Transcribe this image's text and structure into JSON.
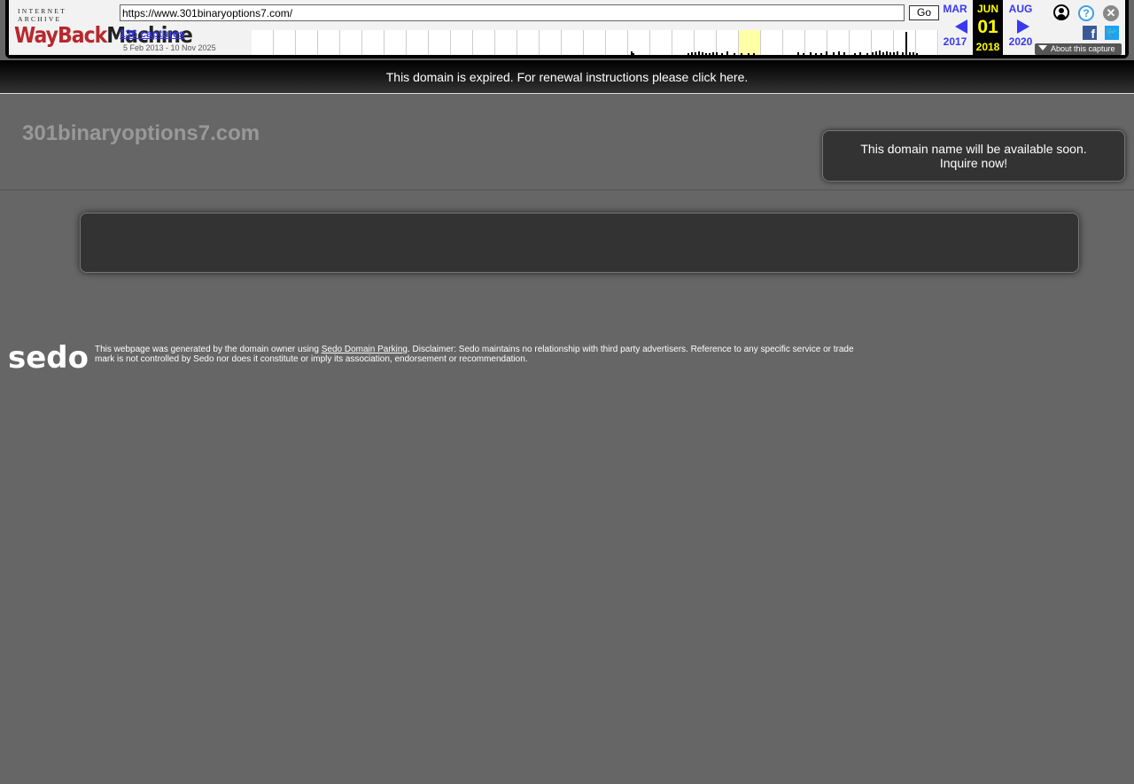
{
  "wayback": {
    "logo_top": "INTERNET ARCHIVE",
    "logo_wayback": "WayBack",
    "logo_machine": "Machine",
    "url": "https://www.301binaryoptions7.com/",
    "go_label": "Go",
    "captures_label": "136 captures",
    "date_range": "5 Feb 2013 - 10 Nov 2025",
    "prev": {
      "month": "MAR",
      "year": "2017"
    },
    "current": {
      "month": "JUN",
      "day": "01",
      "year": "2018"
    },
    "next": {
      "month": "AUG",
      "year": "2020"
    },
    "about_label": "About this capture",
    "icons": [
      "user-icon",
      "help-icon",
      "close-icon",
      "facebook-icon",
      "twitter-icon"
    ],
    "highlight_color": "#ffffa5",
    "link_color": "#3838f5"
  },
  "banner": {
    "text": "This domain is expired. For renewal instructions please click here."
  },
  "header": {
    "domain": "301binaryoptions7.com",
    "inquire_line1": "This domain name will be available soon.",
    "inquire_line2": "Inquire now!"
  },
  "footer": {
    "logo": "sedo",
    "disclaimer_pre": "This webpage was generated by the domain owner using ",
    "disclaimer_link": "Sedo Domain Parking",
    "disclaimer_post": ". Disclaimer: Sedo maintains no relationship with third party advertisers. Reference to any specific service or trade mark is not controlled by Sedo nor does it constitute or imply its association, endorsement or recommendation."
  }
}
